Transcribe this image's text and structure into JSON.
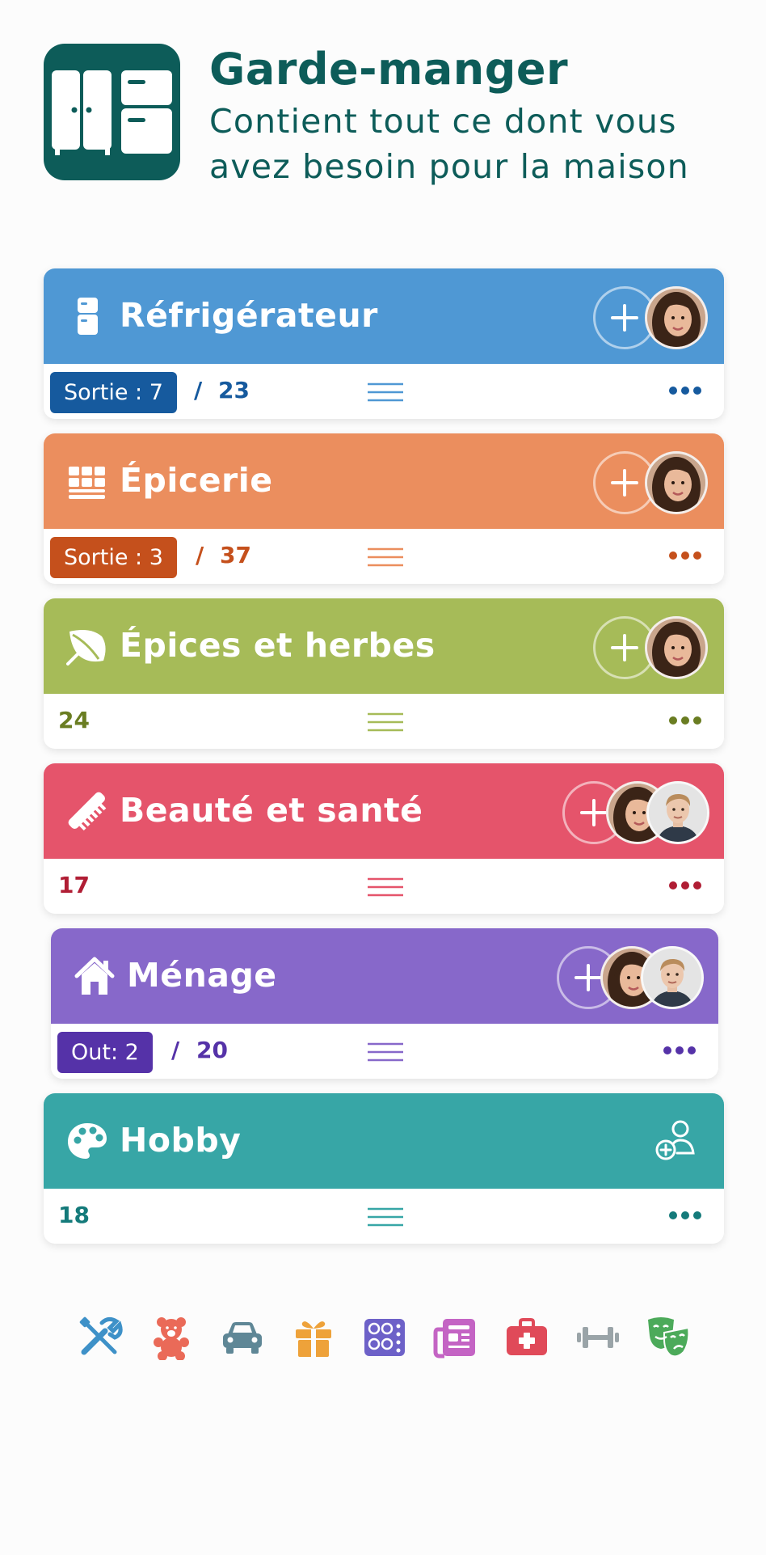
{
  "app": {
    "title": "Garde-manger",
    "subtitle": "Contient tout ce dont vous avez besoin pour la maison",
    "icon": "wardrobe-fridge-icon",
    "color": "#0d5c59"
  },
  "lists": [
    {
      "title": "Réfrigérateur",
      "icon": "fridge-icon",
      "color": "#4f98d4",
      "accent": "#165a9e",
      "badge": "Sortie : 7",
      "total": "23",
      "members": 1
    },
    {
      "title": "Épicerie",
      "icon": "grocery-grid-icon",
      "color": "#eb8e5e",
      "accent": "#c5501c",
      "badge": "Sortie : 3",
      "total": "37",
      "members": 1
    },
    {
      "title": "Épices et herbes",
      "icon": "leaf-icon",
      "color": "#a6bb58",
      "accent": "#6a7d22",
      "count": "24",
      "members": 1
    },
    {
      "title": "Beauté et santé",
      "icon": "comb-icon",
      "color": "#e5546b",
      "accent": "#b01d34",
      "count": "17",
      "members": 2
    },
    {
      "title": "Ménage",
      "icon": "house-icon",
      "color": "#8768ca",
      "accent": "#5532a8",
      "badge": "Out: 2",
      "total": "20",
      "members": 2
    },
    {
      "title": "Hobby",
      "icon": "palette-icon",
      "color": "#37a6a6",
      "accent": "#147a7a",
      "count": "18",
      "members": 0
    }
  ],
  "category_icons": [
    {
      "name": "tools-icon",
      "color": "#3e91c8"
    },
    {
      "name": "teddy-bear-icon",
      "color": "#ea6a58"
    },
    {
      "name": "car-icon",
      "color": "#5f8796"
    },
    {
      "name": "gift-icon",
      "color": "#eea23a"
    },
    {
      "name": "stove-icon",
      "color": "#6d61c8"
    },
    {
      "name": "newspaper-icon",
      "color": "#c464c4"
    },
    {
      "name": "first-aid-kit-icon",
      "color": "#e04a59"
    },
    {
      "name": "dumbbell-icon",
      "color": "#9aa4a8"
    },
    {
      "name": "theater-masks-icon",
      "color": "#4caa5a"
    }
  ]
}
